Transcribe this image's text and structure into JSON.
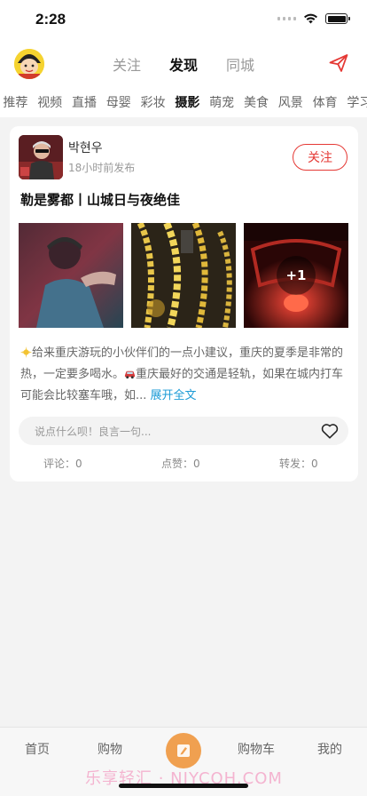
{
  "status_bar": {
    "time": "2:28"
  },
  "top_nav": {
    "tabs": [
      {
        "label": "关注"
      },
      {
        "label": "发现"
      },
      {
        "label": "同城"
      }
    ],
    "active_tab": "发现"
  },
  "categories": {
    "items": [
      "推荐",
      "视频",
      "直播",
      "母婴",
      "彩妆",
      "摄影",
      "萌宠",
      "美食",
      "风景",
      "体育",
      "学习"
    ],
    "active": "摄影"
  },
  "post": {
    "author": "박현우",
    "time": "18小时前发布",
    "follow_label": "关注",
    "title": "勒是雾都丨山城日与夜绝佳",
    "more_photos": "+1",
    "body_part1": "给来重庆游玩的小伙伴们的一点小建议，重庆的夏季是非常的热，一定要多喝水。",
    "body_part2": "重庆最好的交通是轻轨，如果在城内打车可能会比较塞车哦，如...",
    "expand_label": "展开全文",
    "comment_placeholder": "说点什么呗！良言一句...",
    "stats": {
      "comments": "评论：0",
      "likes": "点赞：0",
      "shares": "转发：0"
    }
  },
  "tab_bar": {
    "items": [
      {
        "label": "首页"
      },
      {
        "label": "购物"
      },
      {
        "label": "购物车"
      },
      {
        "label": "我的"
      }
    ]
  },
  "watermark": "乐享轻汇 · NJYCQH.COM",
  "colors": {
    "accent_red": "#e53935",
    "link_blue": "#1a9ad6",
    "center_tab": "#f0a050"
  }
}
